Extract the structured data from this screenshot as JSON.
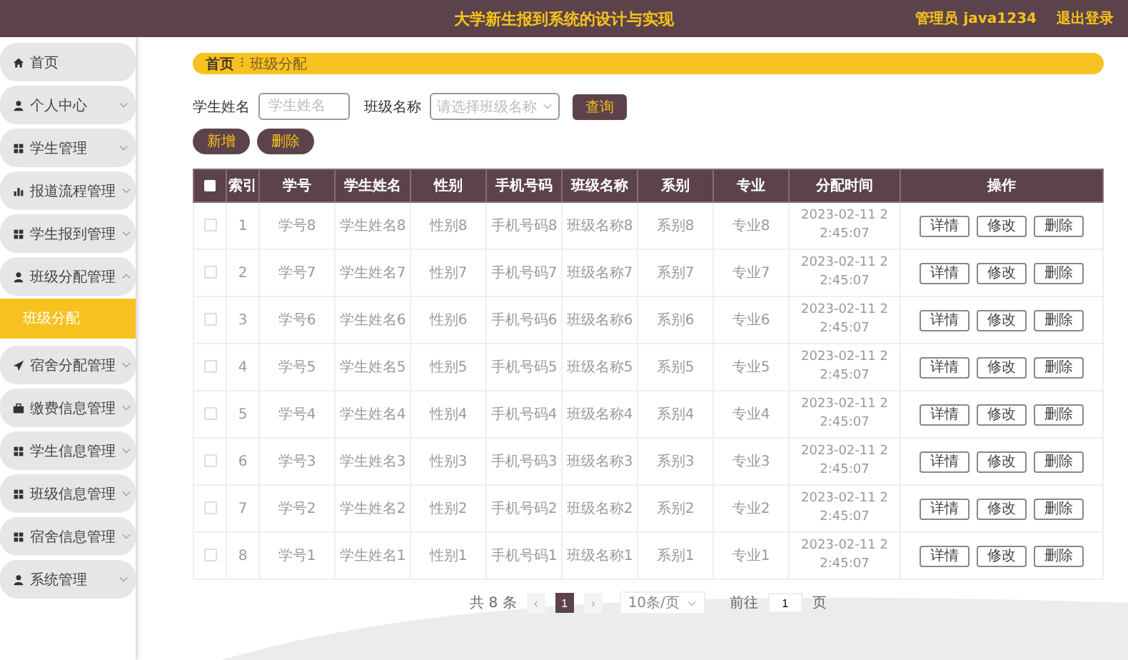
{
  "header": {
    "title": "大学新生报到系统的设计与实现",
    "user": "管理员 java1234",
    "logout": "退出登录"
  },
  "sidebar": {
    "items": [
      {
        "label": "首页",
        "kind": "home"
      },
      {
        "label": "个人中心",
        "kind": "user",
        "expanded": false
      },
      {
        "label": "学生管理",
        "kind": "grid",
        "expanded": false
      },
      {
        "label": "报道流程管理",
        "kind": "chart",
        "expanded": false
      },
      {
        "label": "学生报到管理",
        "kind": "grid",
        "expanded": false
      },
      {
        "label": "班级分配管理",
        "kind": "user",
        "expanded": true,
        "children": [
          {
            "label": "班级分配",
            "selected": true
          }
        ]
      },
      {
        "label": "宿舍分配管理",
        "kind": "send",
        "expanded": false
      },
      {
        "label": "缴费信息管理",
        "kind": "bag",
        "expanded": false
      },
      {
        "label": "学生信息管理",
        "kind": "grid",
        "expanded": false
      },
      {
        "label": "班级信息管理",
        "kind": "grid",
        "expanded": false
      },
      {
        "label": "宿舍信息管理",
        "kind": "grid",
        "expanded": false
      },
      {
        "label": "系统管理",
        "kind": "user",
        "expanded": false
      }
    ]
  },
  "breadcrumb": {
    "items": [
      "首页",
      "班级分配"
    ],
    "separator": "⁝"
  },
  "search": {
    "fields": [
      {
        "kind": "text",
        "label": "学生姓名",
        "placeholder": "学生姓名"
      },
      {
        "kind": "select",
        "label": "班级名称",
        "placeholder": "请选择班级名称"
      }
    ],
    "button": "查询"
  },
  "actions": [
    "新增",
    "删除"
  ],
  "table": {
    "all_checked": false,
    "columns": [
      "索引",
      "学号",
      "学生姓名",
      "性别",
      "手机号码",
      "班级名称",
      "系别",
      "专业",
      "分配时间",
      "操作"
    ],
    "rows": [
      {
        "checked": false,
        "cells": [
          "1",
          "学号8",
          "学生姓名8",
          "性别8",
          "手机号码8",
          "班级名称8",
          "系别8",
          "专业8",
          "2023-02-11 22:45:07"
        ],
        "buttons": [
          "详情",
          "修改",
          "删除"
        ]
      },
      {
        "checked": false,
        "cells": [
          "2",
          "学号7",
          "学生姓名7",
          "性别7",
          "手机号码7",
          "班级名称7",
          "系别7",
          "专业7",
          "2023-02-11 22:45:07"
        ],
        "buttons": [
          "详情",
          "修改",
          "删除"
        ]
      },
      {
        "checked": false,
        "cells": [
          "3",
          "学号6",
          "学生姓名6",
          "性别6",
          "手机号码6",
          "班级名称6",
          "系别6",
          "专业6",
          "2023-02-11 22:45:07"
        ],
        "buttons": [
          "详情",
          "修改",
          "删除"
        ]
      },
      {
        "checked": false,
        "cells": [
          "4",
          "学号5",
          "学生姓名5",
          "性别5",
          "手机号码5",
          "班级名称5",
          "系别5",
          "专业5",
          "2023-02-11 22:45:07"
        ],
        "buttons": [
          "详情",
          "修改",
          "删除"
        ]
      },
      {
        "checked": false,
        "cells": [
          "5",
          "学号4",
          "学生姓名4",
          "性别4",
          "手机号码4",
          "班级名称4",
          "系别4",
          "专业4",
          "2023-02-11 22:45:07"
        ],
        "buttons": [
          "详情",
          "修改",
          "删除"
        ]
      },
      {
        "checked": false,
        "cells": [
          "6",
          "学号3",
          "学生姓名3",
          "性别3",
          "手机号码3",
          "班级名称3",
          "系别3",
          "专业3",
          "2023-02-11 22:45:07"
        ],
        "buttons": [
          "详情",
          "修改",
          "删除"
        ]
      },
      {
        "checked": false,
        "cells": [
          "7",
          "学号2",
          "学生姓名2",
          "性别2",
          "手机号码2",
          "班级名称2",
          "系别2",
          "专业2",
          "2023-02-11 22:45:07"
        ],
        "buttons": [
          "详情",
          "修改",
          "删除"
        ]
      },
      {
        "checked": false,
        "cells": [
          "8",
          "学号1",
          "学生姓名1",
          "性别1",
          "手机号码1",
          "班级名称1",
          "系别1",
          "专业1",
          "2023-02-11 22:45:07"
        ],
        "buttons": [
          "详情",
          "修改",
          "删除"
        ]
      }
    ]
  },
  "pagination": {
    "total": "共 8 条",
    "prev": "‹",
    "pages": [
      {
        "label": "1",
        "selected": true
      }
    ],
    "next": "›",
    "page_size": "10条/页",
    "goto_label": "前往",
    "goto_value": "1",
    "goto_unit": "页"
  }
}
